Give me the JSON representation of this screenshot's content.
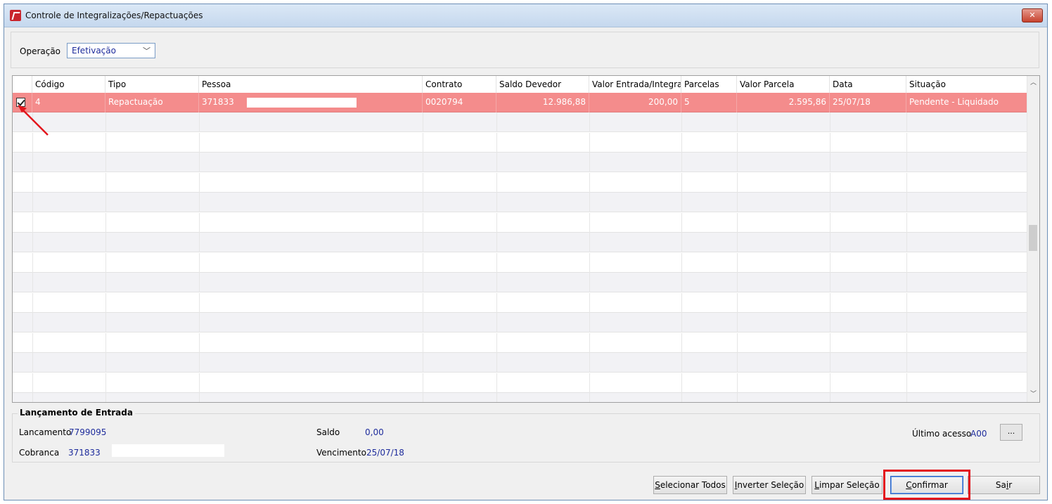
{
  "window": {
    "title": "Controle de Integralizações/Repactuações",
    "close_label": "✕"
  },
  "operacao": {
    "label": "Operação",
    "value": "Efetivação"
  },
  "grid": {
    "columns": [
      "",
      "Código",
      "Tipo",
      "Pessoa",
      "Contrato",
      "Saldo Devedor",
      "Valor Entrada/Integrali...",
      "Parcelas",
      "Valor Parcela",
      "Data",
      "Situação"
    ],
    "rows": [
      {
        "checked": true,
        "codigo": "4",
        "tipo": "Repactuação",
        "pessoa": "371833",
        "contrato": "0020794",
        "saldo_devedor": "12.986,88",
        "valor_entrada": "200,00",
        "parcelas": "5",
        "valor_parcela": "2.595,86",
        "data": "25/07/18",
        "situacao": "Pendente - Liquidado"
      }
    ]
  },
  "entrada": {
    "legend": "Lançamento de Entrada",
    "lancamento_label": "Lancamento",
    "lancamento_value": "7799095",
    "cobranca_label": "Cobranca",
    "cobranca_value": "371833",
    "saldo_label": "Saldo",
    "saldo_value": "0,00",
    "vencimento_label": "Vencimento",
    "vencimento_value": "25/07/18",
    "ultimo_acesso_label": "Último acesso",
    "ultimo_acesso_value": "A00",
    "dots_label": "..."
  },
  "buttons": {
    "selecionar_todos": {
      "ul": "S",
      "rest": "elecionar Todos"
    },
    "inverter_selecao": {
      "ul": "I",
      "rest": "nverter Seleção"
    },
    "limpar_selecao": {
      "ul": "L",
      "rest": "impar Seleção"
    },
    "confirmar": {
      "ul": "C",
      "rest": "onfirmar"
    },
    "sair": {
      "pre": "Sa",
      "ul": "i",
      "rest": "r"
    }
  },
  "colors": {
    "selected_row": "#f48c8c",
    "value_text": "#1e2c9c",
    "highlight": "#e3141c"
  }
}
